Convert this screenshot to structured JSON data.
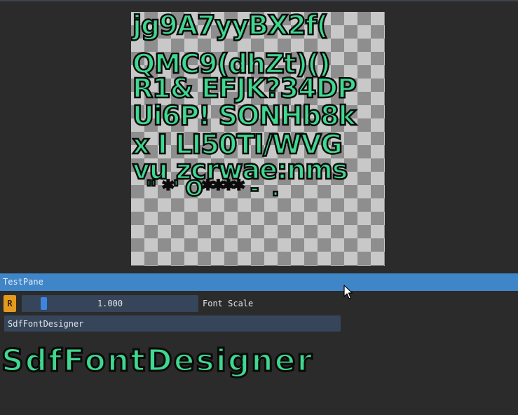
{
  "atlas": {
    "rows": [
      "jg9A7yyBX2f(",
      "QMC9(dhZt)()",
      "R1& EFJK?34DP",
      "Ui6P! SONHb8k",
      "x I LI50TI/WVG",
      "vu zcrwae:nms",
      "  \" *' O**** -  ."
    ]
  },
  "pane": {
    "title": "TestPane"
  },
  "font_scale": {
    "reset_label": "R",
    "value_text": "1.000",
    "value": 1.0,
    "fraction": 0.1,
    "label": "Font Scale"
  },
  "text_field": {
    "value": "SdfFontDesigner"
  },
  "preview": {
    "text": "SdfFontDesigner"
  },
  "colors": {
    "glyph_fill": "#3fd88f",
    "glyph_outline": "#0b0b0b",
    "header": "#3f86c9",
    "reset_button": "#e29a1f",
    "slider_grab": "#3d85e0",
    "frame_bg": "#364559",
    "background": "#2b2b2b"
  },
  "icons": {
    "cursor": "mouse-pointer-icon"
  }
}
